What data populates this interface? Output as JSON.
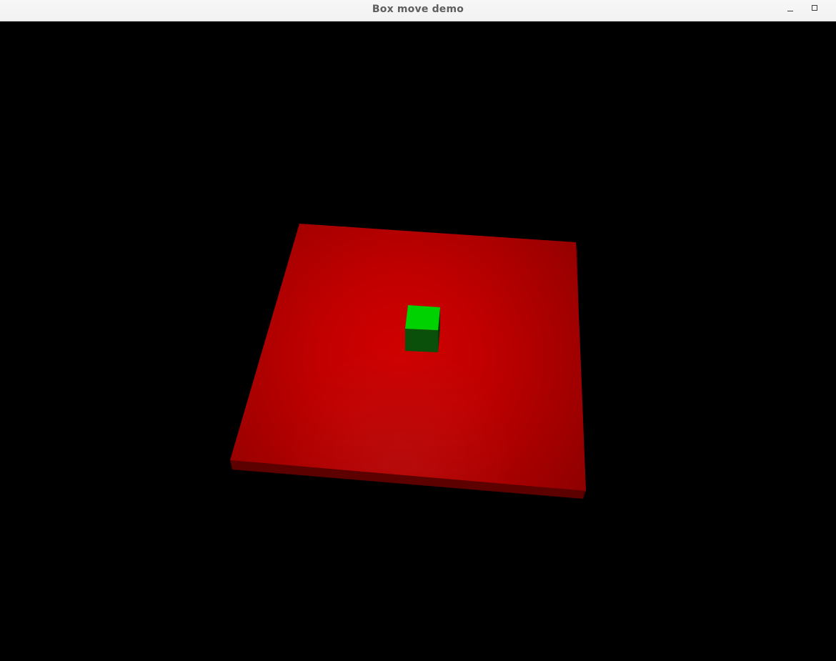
{
  "window": {
    "title": "Box move demo",
    "controls": [
      "minimize-icon",
      "maximize-icon"
    ]
  },
  "scene": {
    "background_color": "#000000",
    "platform": {
      "color": "#c80000",
      "side_color": "#5c0000"
    },
    "box": {
      "top_color": "#00d100",
      "front_color": "#0a4f0a",
      "side_color": "#063606"
    }
  }
}
